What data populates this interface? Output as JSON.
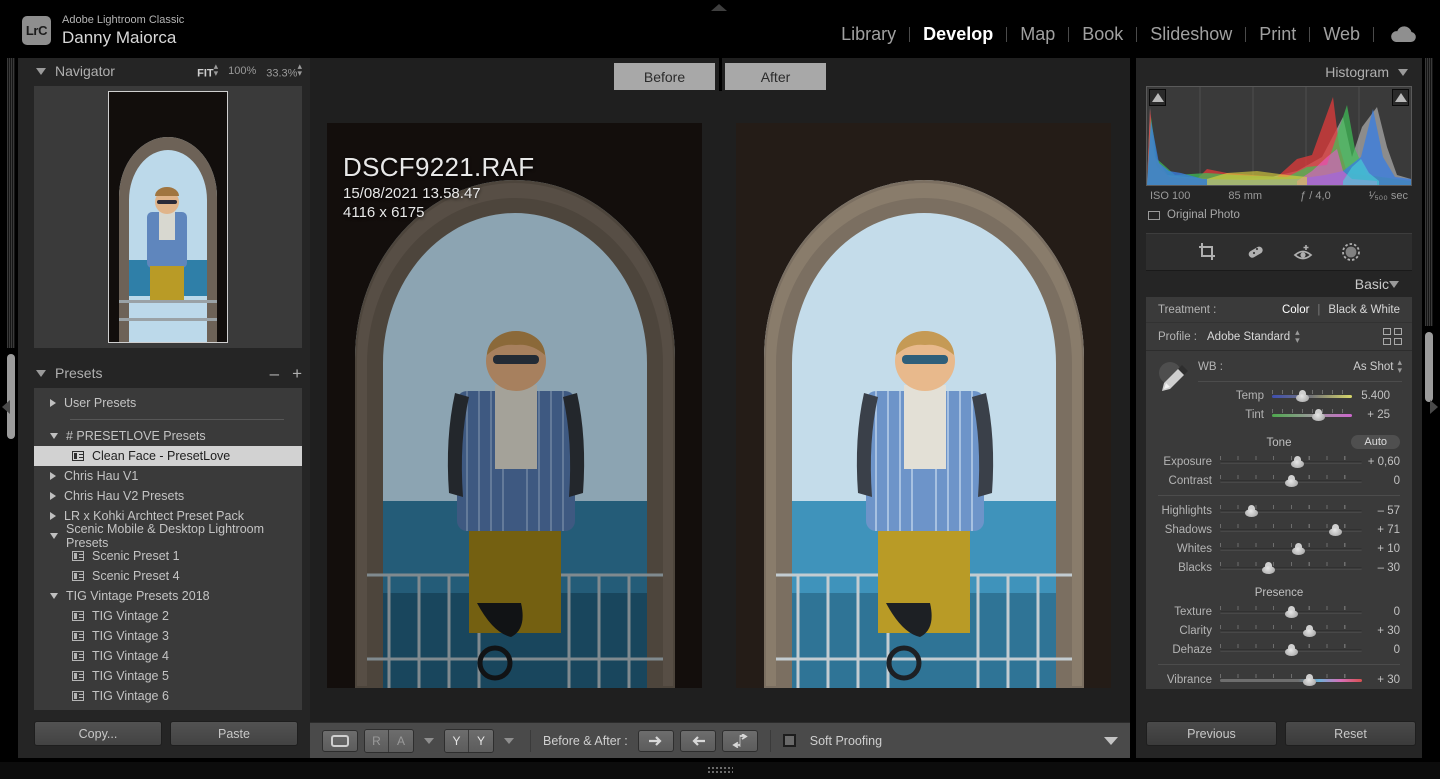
{
  "app": {
    "logo_text": "LrC",
    "product": "Adobe Lightroom Classic",
    "user": "Danny Maiorca"
  },
  "modules": [
    {
      "label": "Library",
      "active": false
    },
    {
      "label": "Develop",
      "active": true
    },
    {
      "label": "Map",
      "active": false
    },
    {
      "label": "Book",
      "active": false
    },
    {
      "label": "Slideshow",
      "active": false
    },
    {
      "label": "Print",
      "active": false
    },
    {
      "label": "Web",
      "active": false
    }
  ],
  "navigator": {
    "title": "Navigator",
    "fit_label": "FIT",
    "zoom_100": "100%",
    "zoom_custom": "33.3%"
  },
  "presets": {
    "title": "Presets",
    "minus_label": "–",
    "plus_label": "+",
    "items": [
      {
        "label": "User Presets",
        "type": "group",
        "expanded": false,
        "selected": false
      },
      {
        "label": "# PRESETLOVE Presets",
        "type": "group",
        "expanded": true,
        "selected": false
      },
      {
        "label": "Clean Face - PresetLove",
        "type": "item",
        "selected": true
      },
      {
        "label": "Chris Hau V1",
        "type": "group",
        "expanded": false,
        "selected": false
      },
      {
        "label": "Chris Hau V2 Presets",
        "type": "group",
        "expanded": false,
        "selected": false
      },
      {
        "label": "LR x Kohki Archtect Preset Pack",
        "type": "group",
        "expanded": false,
        "selected": false
      },
      {
        "label": "Scenic Mobile & Desktop Lightroom Presets",
        "type": "group",
        "expanded": true,
        "selected": false
      },
      {
        "label": "Scenic Preset 1",
        "type": "item",
        "selected": false
      },
      {
        "label": "Scenic Preset 4",
        "type": "item",
        "selected": false
      },
      {
        "label": "TIG Vintage Presets 2018",
        "type": "group",
        "expanded": true,
        "selected": false
      },
      {
        "label": "TIG Vintage 2",
        "type": "item",
        "selected": false
      },
      {
        "label": "TIG Vintage 3",
        "type": "item",
        "selected": false
      },
      {
        "label": "TIG Vintage 4",
        "type": "item",
        "selected": false
      },
      {
        "label": "TIG Vintage 5",
        "type": "item",
        "selected": false
      },
      {
        "label": "TIG Vintage 6",
        "type": "item",
        "selected": false
      }
    ],
    "copy_label": "Copy...",
    "paste_label": "Paste"
  },
  "photo": {
    "filename": "DSCF9221.RAF",
    "capture_datetime": "15/08/2021 13.58.47",
    "dimensions": "4116 x 6175",
    "before_label": "Before",
    "after_label": "After"
  },
  "histogram": {
    "title": "Histogram",
    "iso": "ISO 100",
    "focal_length": "85 mm",
    "aperture": "ƒ / 4,0",
    "shutter": "¹⁄₅₀₀ sec",
    "original_photo_label": "Original Photo"
  },
  "tools": [
    {
      "name": "crop-overlay-tool"
    },
    {
      "name": "spot-removal-tool"
    },
    {
      "name": "red-eye-correction-tool"
    },
    {
      "name": "masking-tool"
    }
  ],
  "basic": {
    "title": "Basic",
    "treatment_label": "Treatment :",
    "treatment_color": "Color",
    "treatment_bw": "Black & White",
    "profile_label": "Profile :",
    "profile_value": "Adobe Standard",
    "wb_label": "WB :",
    "wb_value": "As Shot",
    "tone_title": "Tone",
    "auto_label": "Auto",
    "presence_title": "Presence",
    "sliders": [
      {
        "label": "Temp",
        "value": "5.400",
        "pos": 37,
        "track": "temp"
      },
      {
        "label": "Tint",
        "value": "+ 25",
        "pos": 57,
        "track": "tint"
      },
      {
        "label": "Exposure",
        "value": "+ 0,60",
        "pos": 54,
        "track": "plain"
      },
      {
        "label": "Contrast",
        "value": "0",
        "pos": 50,
        "track": "plain"
      },
      {
        "label": "Highlights",
        "value": "– 57",
        "pos": 22,
        "track": "plain"
      },
      {
        "label": "Shadows",
        "value": "+ 71",
        "pos": 81,
        "track": "plain"
      },
      {
        "label": "Whites",
        "value": "+ 10",
        "pos": 55,
        "track": "plain"
      },
      {
        "label": "Blacks",
        "value": "– 30",
        "pos": 34,
        "track": "plain"
      },
      {
        "label": "Texture",
        "value": "0",
        "pos": 50,
        "track": "plain"
      },
      {
        "label": "Clarity",
        "value": "+ 30",
        "pos": 63,
        "track": "plain"
      },
      {
        "label": "Dehaze",
        "value": "0",
        "pos": 50,
        "track": "plain"
      },
      {
        "label": "Vibrance",
        "value": "+ 30",
        "pos": 63,
        "track": "vib"
      }
    ],
    "previous_label": "Previous",
    "reset_label": "Reset"
  },
  "toolbar": {
    "loupe_label": "",
    "reference_r": "R",
    "reference_a": "A",
    "beforeafter_y1": "Y",
    "beforeafter_y2": "Y",
    "before_after_label": "Before & After :",
    "copy_after_to_before": "→",
    "copy_before_to_after": "←",
    "swap_before_after": "⇅",
    "soft_proofing_label": "Soft Proofing",
    "soft_proofing_checked": false
  },
  "colors": {
    "panel_bg": "#252525",
    "section_bg": "#3a3a3a",
    "accent_selected": "#d2d2d2",
    "text_primary": "#c4c4c4"
  }
}
